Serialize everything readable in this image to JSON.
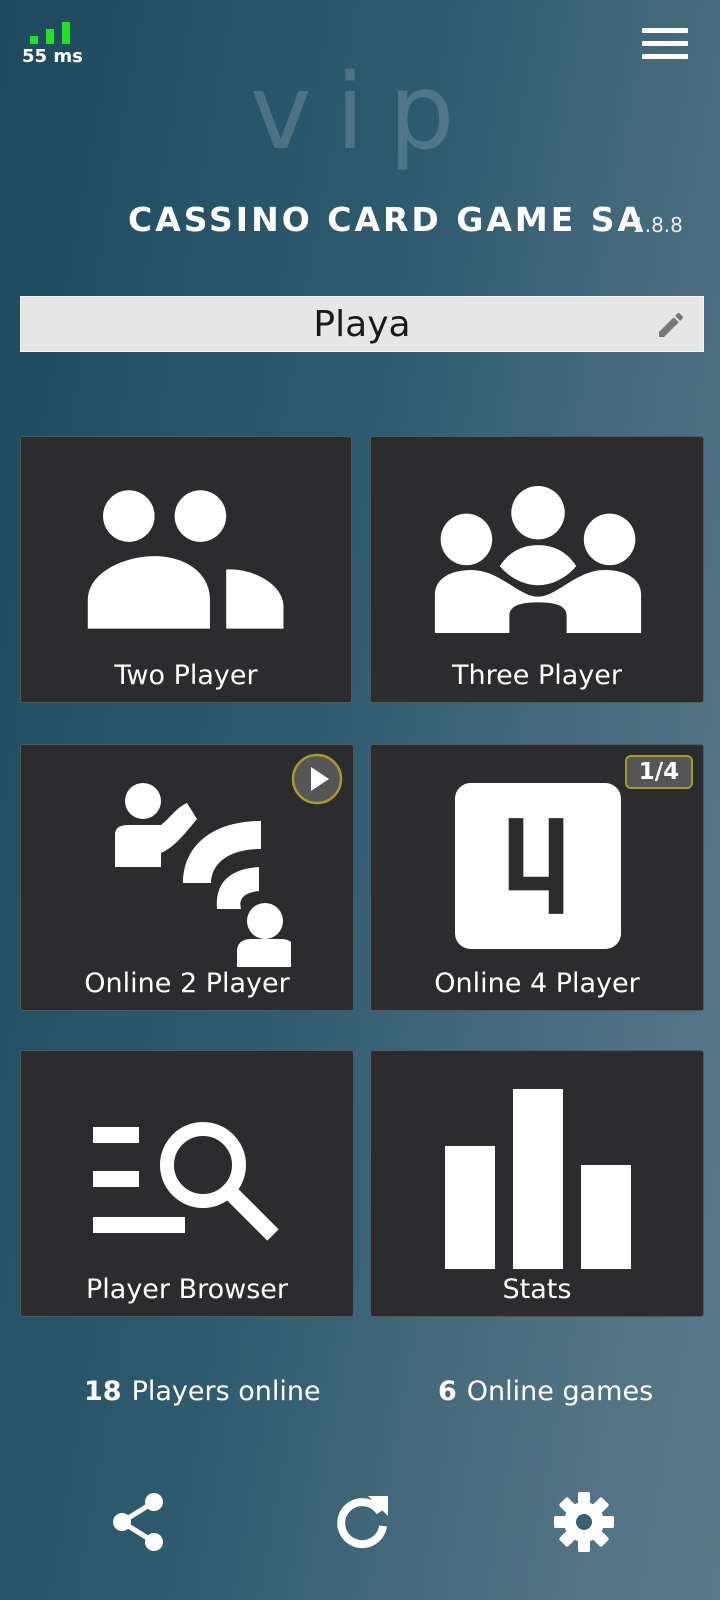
{
  "status": {
    "ping_label": "55 ms",
    "signal_color": "#22e022"
  },
  "header": {
    "logo_text": "vip",
    "title": "CASSINO CARD GAME SA",
    "version": "1.8.8",
    "menu_icon": "hamburger-menu-icon"
  },
  "player_name": {
    "value": "Playa",
    "edit_icon": "pencil-icon"
  },
  "tiles": [
    {
      "label": "Two Player",
      "icon": "two-people-icon"
    },
    {
      "label": "Three Player",
      "icon": "three-people-icon"
    },
    {
      "label": "Online 2 Player",
      "icon": "online-two-player-icon",
      "badge_icon": "play-icon"
    },
    {
      "label": "Online 4 Player",
      "icon": "four-square-icon",
      "badge": "1/4"
    },
    {
      "label": "Player Browser",
      "icon": "list-search-icon"
    },
    {
      "label": "Stats",
      "icon": "bar-chart-icon"
    }
  ],
  "footer": {
    "players_online_count": "18",
    "players_online_label": "Players online",
    "online_games_count": "6",
    "online_games_label": "Online games"
  },
  "bottom_bar": {
    "share_icon": "share-icon",
    "refresh_icon": "refresh-icon",
    "settings_icon": "gear-icon"
  },
  "colors": {
    "tile_bg": "#2c2c2e",
    "badge_border": "#a69a2a"
  }
}
